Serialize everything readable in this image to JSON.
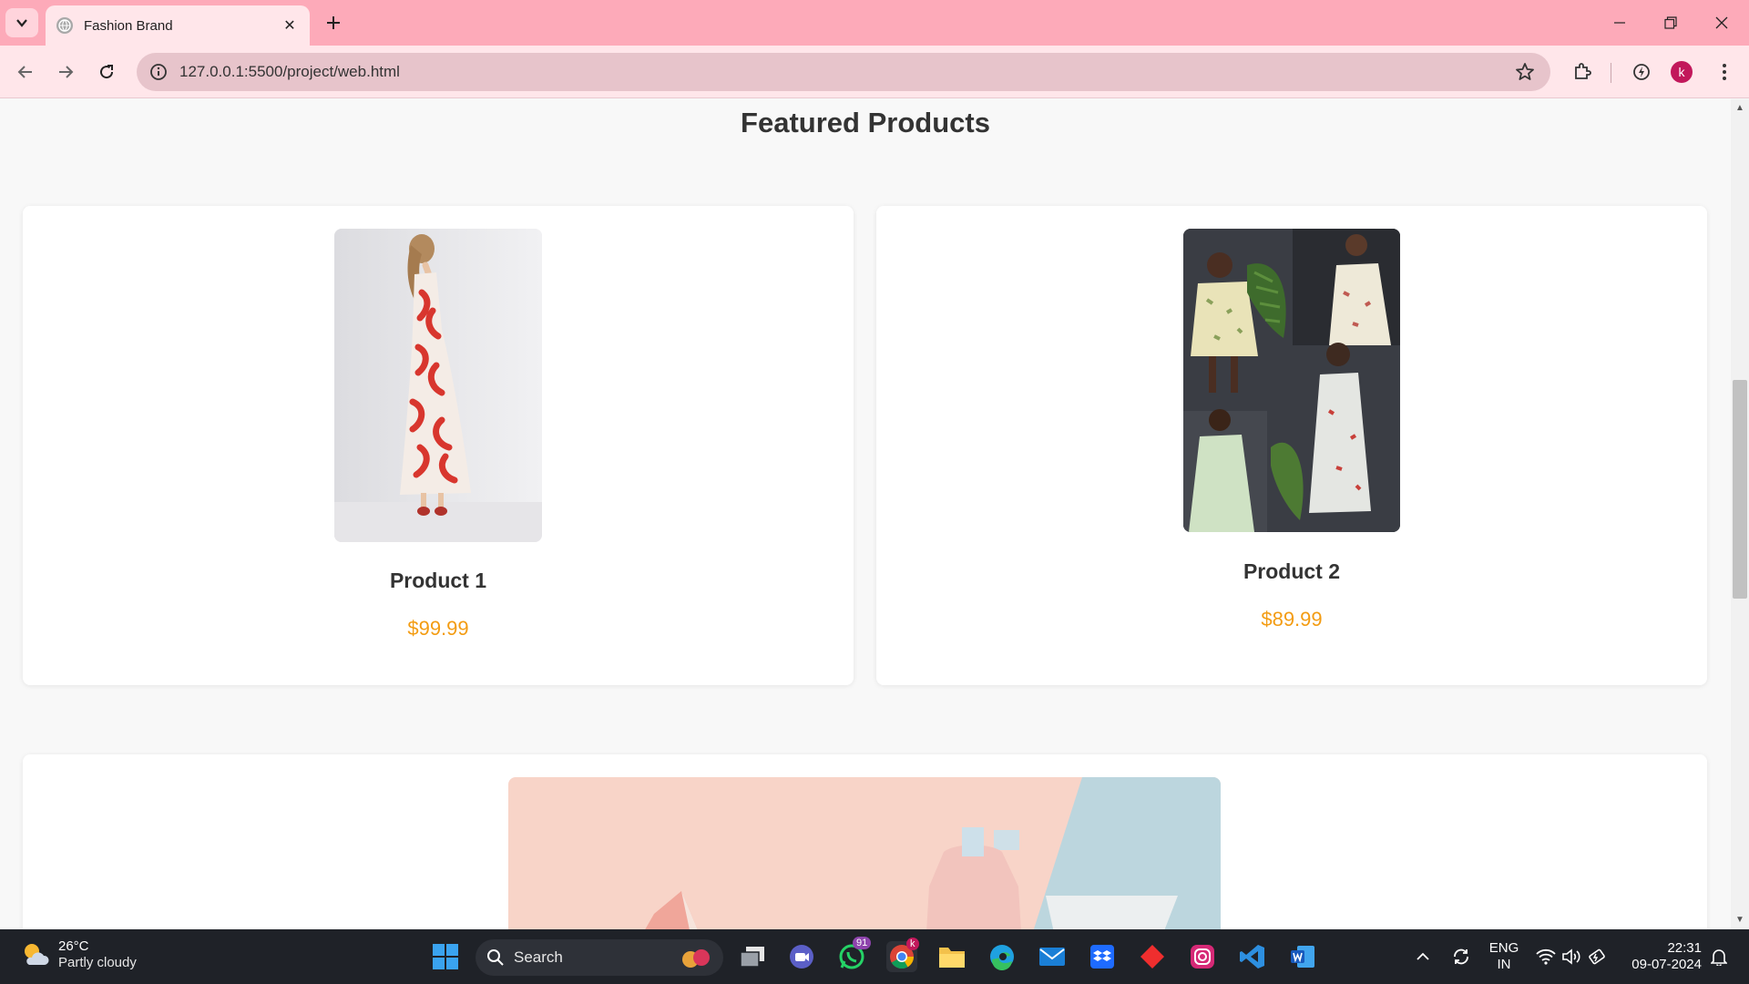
{
  "browser": {
    "tab_title": "Fashion Brand",
    "url": "127.0.0.1:5500/project/web.html",
    "profile_initial": "k"
  },
  "page": {
    "section_title": "Featured Products",
    "products": [
      {
        "name": "Product 1",
        "price": "$99.99"
      },
      {
        "name": "Product 2",
        "price": "$89.99"
      }
    ]
  },
  "taskbar": {
    "weather_temp": "26°C",
    "weather_condition": "Partly cloudy",
    "search_label": "Search",
    "whatsapp_badge": "91",
    "chrome_badge": "k",
    "language_line1": "ENG",
    "language_line2": "IN",
    "time": "22:31",
    "date": "09-07-2024"
  },
  "colors": {
    "tab_strip": "#fdaab9",
    "toolbar": "#ffe6ea",
    "price": "#f39c12",
    "page_background": "#f8f8f8"
  }
}
